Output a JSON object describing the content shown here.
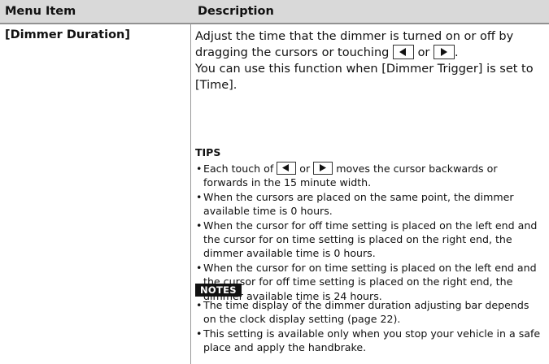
{
  "table": {
    "headers": {
      "menu_item": "Menu Item",
      "description": "Description"
    },
    "row": {
      "menu_item": "[Dimmer Duration]",
      "description": {
        "line1": "Adjust the time that the dimmer is turned on or off by",
        "line2_before": "dragging the cursors or touching",
        "line2_or": "or",
        "line2_end": ".",
        "line3": "You can use this function when [Dimmer Trigger] is set to",
        "line4": "[Time].",
        "left_icon": "left-arrow-button-icon",
        "right_icon": "right-arrow-button-icon"
      },
      "tips": {
        "heading": "TIPS",
        "items": [
          {
            "before": "Each touch of",
            "or": "or",
            "after": "moves the cursor backwards or",
            "line2": "forwards in the 15 minute width."
          },
          {
            "line1": "When the cursors are placed on the same point, the dimmer",
            "line2": "available time is 0 hours."
          },
          {
            "line1": "When the cursor for off time setting is placed on the left end and",
            "line2": "the cursor for on time setting is placed on the right end, the",
            "line3": "dimmer available time is 0 hours."
          },
          {
            "line1": "When the cursor for on time setting is placed on the left end and",
            "line2": "the cursor for off time setting is placed on the right end, the",
            "line3": "dimmer available time is 24 hours."
          }
        ]
      },
      "notes": {
        "heading": "NOTES",
        "items": [
          {
            "line1": "The time display of the dimmer duration adjusting bar depends",
            "line2": "on the clock display setting (page 22)."
          },
          {
            "line1": "This setting is available only when you stop your vehicle in a safe",
            "line2": "place and apply the handbrake."
          }
        ]
      }
    }
  },
  "colors": {
    "header_bg": "#d9d9d9",
    "notes_badge_bg": "#111111",
    "text": "#111111"
  }
}
